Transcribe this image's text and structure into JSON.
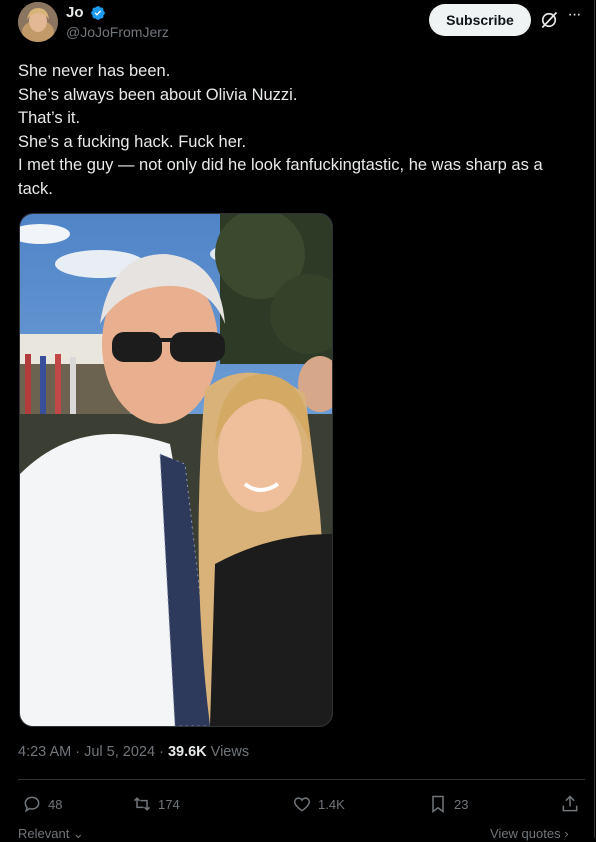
{
  "user": {
    "display_name": "Jo",
    "handle": "@JoJoFromJerz",
    "verified": true,
    "avatar_icon": "profile-photo"
  },
  "header": {
    "subscribe_label": "Subscribe",
    "grok_icon": "grok-icon",
    "more_icon": "more-icon",
    "more_glyph": "···"
  },
  "tweet": {
    "lines": [
      "She never has been.",
      "She’s always been about Olivia Nuzzi.",
      "That’s it.",
      "She’s a fucking hack. Fuck her.",
      "I met the guy — not only did he look fanfuckingtastic, he was sharp as a tack."
    ]
  },
  "meta": {
    "time": "4:23 AM",
    "date": "Jul 5, 2024",
    "separator": " · ",
    "views_count": "39.6K",
    "views_label": " Views"
  },
  "actions": {
    "replies": "48",
    "reposts": "174",
    "likes": "1.4K",
    "bookmarks": "23"
  },
  "footer": {
    "relevant_label": "Relevant ⌄",
    "view_quotes_label": "View quotes ›"
  },
  "colors": {
    "background": "#000000",
    "text": "#e7e9ea",
    "muted": "#71767b",
    "verified": "#1d9bf0"
  }
}
